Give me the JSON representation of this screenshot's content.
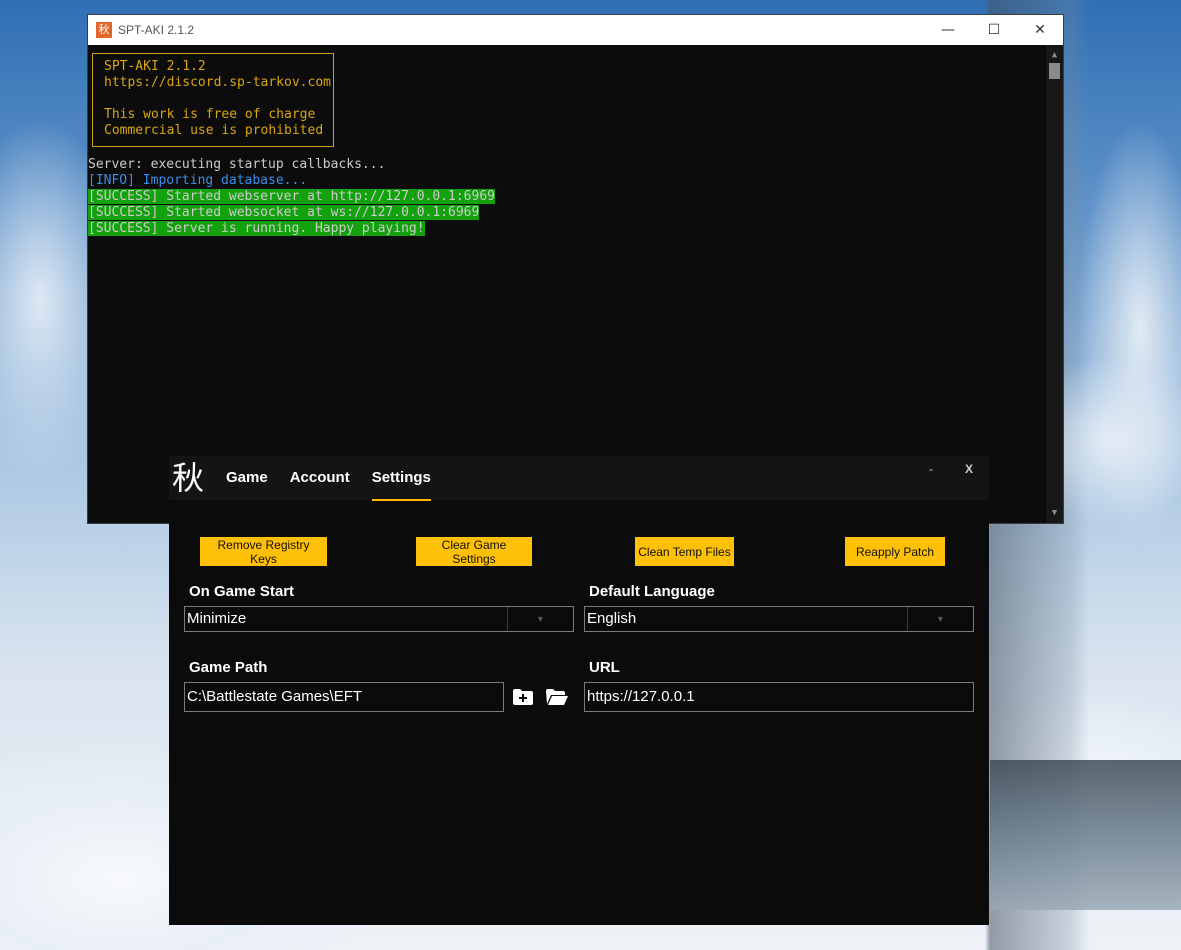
{
  "console": {
    "title": "SPT-AKI 2.1.2",
    "app_icon_glyph": "秋",
    "controls": {
      "minimize": "—",
      "maximize": "☐",
      "close": "✕"
    },
    "banner": [
      "SPT-AKI 2.1.2",
      "https://discord.sp-tarkov.com",
      "",
      "This work is free of charge",
      "Commercial use is prohibited"
    ],
    "logs": {
      "line1": "Server: executing startup callbacks...",
      "line2": "[INFO] Importing database...",
      "line3": "[SUCCESS] Started webserver at http://127.0.0.1:6969",
      "line4": "[SUCCESS] Started websocket at ws://127.0.0.1:6969",
      "line5": "[SUCCESS] Server is running. Happy playing!"
    },
    "colors": {
      "background": "#0c0c0c",
      "banner": "#d9a514",
      "info": "#3b8eea",
      "success_bg": "#13a10e"
    }
  },
  "launcher": {
    "logo_glyph": "秋",
    "tabs": {
      "game": "Game",
      "account": "Account",
      "settings": "Settings"
    },
    "active_tab": "Settings",
    "window_controls": {
      "minimize": "-",
      "close": "X"
    },
    "buttons": {
      "remove_registry": "Remove Registry Keys",
      "clear_settings": "Clear Game Settings",
      "clean_temp": "Clean Temp Files",
      "reapply_patch": "Reapply Patch"
    },
    "on_game_start": {
      "label": "On Game Start",
      "value": "Minimize"
    },
    "default_language": {
      "label": "Default Language",
      "value": "English"
    },
    "game_path": {
      "label": "Game Path",
      "value": "C:\\Battlestate Games\\EFT"
    },
    "url": {
      "label": "URL",
      "value": "https://127.0.0.1"
    },
    "icons": {
      "add_folder": "folder-plus-icon",
      "open_folder": "folder-open-icon"
    },
    "colors": {
      "accent": "#ffc107",
      "background": "#0b0b0b",
      "nav": "#141414"
    }
  }
}
